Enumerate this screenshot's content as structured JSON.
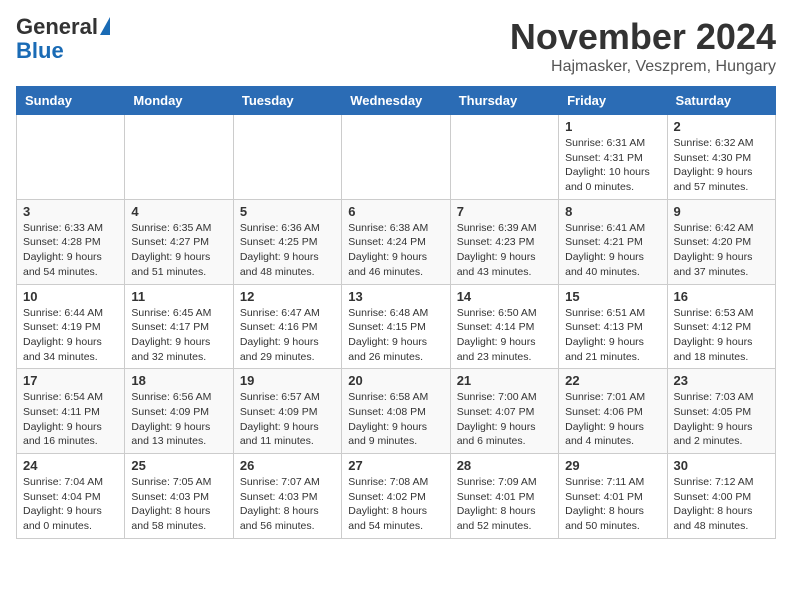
{
  "header": {
    "logo_general": "General",
    "logo_blue": "Blue",
    "title": "November 2024",
    "subtitle": "Hajmasker, Veszprem, Hungary"
  },
  "columns": [
    "Sunday",
    "Monday",
    "Tuesday",
    "Wednesday",
    "Thursday",
    "Friday",
    "Saturday"
  ],
  "weeks": [
    [
      {
        "day": "",
        "info": ""
      },
      {
        "day": "",
        "info": ""
      },
      {
        "day": "",
        "info": ""
      },
      {
        "day": "",
        "info": ""
      },
      {
        "day": "",
        "info": ""
      },
      {
        "day": "1",
        "info": "Sunrise: 6:31 AM\nSunset: 4:31 PM\nDaylight: 10 hours\nand 0 minutes."
      },
      {
        "day": "2",
        "info": "Sunrise: 6:32 AM\nSunset: 4:30 PM\nDaylight: 9 hours\nand 57 minutes."
      }
    ],
    [
      {
        "day": "3",
        "info": "Sunrise: 6:33 AM\nSunset: 4:28 PM\nDaylight: 9 hours\nand 54 minutes."
      },
      {
        "day": "4",
        "info": "Sunrise: 6:35 AM\nSunset: 4:27 PM\nDaylight: 9 hours\nand 51 minutes."
      },
      {
        "day": "5",
        "info": "Sunrise: 6:36 AM\nSunset: 4:25 PM\nDaylight: 9 hours\nand 48 minutes."
      },
      {
        "day": "6",
        "info": "Sunrise: 6:38 AM\nSunset: 4:24 PM\nDaylight: 9 hours\nand 46 minutes."
      },
      {
        "day": "7",
        "info": "Sunrise: 6:39 AM\nSunset: 4:23 PM\nDaylight: 9 hours\nand 43 minutes."
      },
      {
        "day": "8",
        "info": "Sunrise: 6:41 AM\nSunset: 4:21 PM\nDaylight: 9 hours\nand 40 minutes."
      },
      {
        "day": "9",
        "info": "Sunrise: 6:42 AM\nSunset: 4:20 PM\nDaylight: 9 hours\nand 37 minutes."
      }
    ],
    [
      {
        "day": "10",
        "info": "Sunrise: 6:44 AM\nSunset: 4:19 PM\nDaylight: 9 hours\nand 34 minutes."
      },
      {
        "day": "11",
        "info": "Sunrise: 6:45 AM\nSunset: 4:17 PM\nDaylight: 9 hours\nand 32 minutes."
      },
      {
        "day": "12",
        "info": "Sunrise: 6:47 AM\nSunset: 4:16 PM\nDaylight: 9 hours\nand 29 minutes."
      },
      {
        "day": "13",
        "info": "Sunrise: 6:48 AM\nSunset: 4:15 PM\nDaylight: 9 hours\nand 26 minutes."
      },
      {
        "day": "14",
        "info": "Sunrise: 6:50 AM\nSunset: 4:14 PM\nDaylight: 9 hours\nand 23 minutes."
      },
      {
        "day": "15",
        "info": "Sunrise: 6:51 AM\nSunset: 4:13 PM\nDaylight: 9 hours\nand 21 minutes."
      },
      {
        "day": "16",
        "info": "Sunrise: 6:53 AM\nSunset: 4:12 PM\nDaylight: 9 hours\nand 18 minutes."
      }
    ],
    [
      {
        "day": "17",
        "info": "Sunrise: 6:54 AM\nSunset: 4:11 PM\nDaylight: 9 hours\nand 16 minutes."
      },
      {
        "day": "18",
        "info": "Sunrise: 6:56 AM\nSunset: 4:09 PM\nDaylight: 9 hours\nand 13 minutes."
      },
      {
        "day": "19",
        "info": "Sunrise: 6:57 AM\nSunset: 4:09 PM\nDaylight: 9 hours\nand 11 minutes."
      },
      {
        "day": "20",
        "info": "Sunrise: 6:58 AM\nSunset: 4:08 PM\nDaylight: 9 hours\nand 9 minutes."
      },
      {
        "day": "21",
        "info": "Sunrise: 7:00 AM\nSunset: 4:07 PM\nDaylight: 9 hours\nand 6 minutes."
      },
      {
        "day": "22",
        "info": "Sunrise: 7:01 AM\nSunset: 4:06 PM\nDaylight: 9 hours\nand 4 minutes."
      },
      {
        "day": "23",
        "info": "Sunrise: 7:03 AM\nSunset: 4:05 PM\nDaylight: 9 hours\nand 2 minutes."
      }
    ],
    [
      {
        "day": "24",
        "info": "Sunrise: 7:04 AM\nSunset: 4:04 PM\nDaylight: 9 hours\nand 0 minutes."
      },
      {
        "day": "25",
        "info": "Sunrise: 7:05 AM\nSunset: 4:03 PM\nDaylight: 8 hours\nand 58 minutes."
      },
      {
        "day": "26",
        "info": "Sunrise: 7:07 AM\nSunset: 4:03 PM\nDaylight: 8 hours\nand 56 minutes."
      },
      {
        "day": "27",
        "info": "Sunrise: 7:08 AM\nSunset: 4:02 PM\nDaylight: 8 hours\nand 54 minutes."
      },
      {
        "day": "28",
        "info": "Sunrise: 7:09 AM\nSunset: 4:01 PM\nDaylight: 8 hours\nand 52 minutes."
      },
      {
        "day": "29",
        "info": "Sunrise: 7:11 AM\nSunset: 4:01 PM\nDaylight: 8 hours\nand 50 minutes."
      },
      {
        "day": "30",
        "info": "Sunrise: 7:12 AM\nSunset: 4:00 PM\nDaylight: 8 hours\nand 48 minutes."
      }
    ]
  ]
}
